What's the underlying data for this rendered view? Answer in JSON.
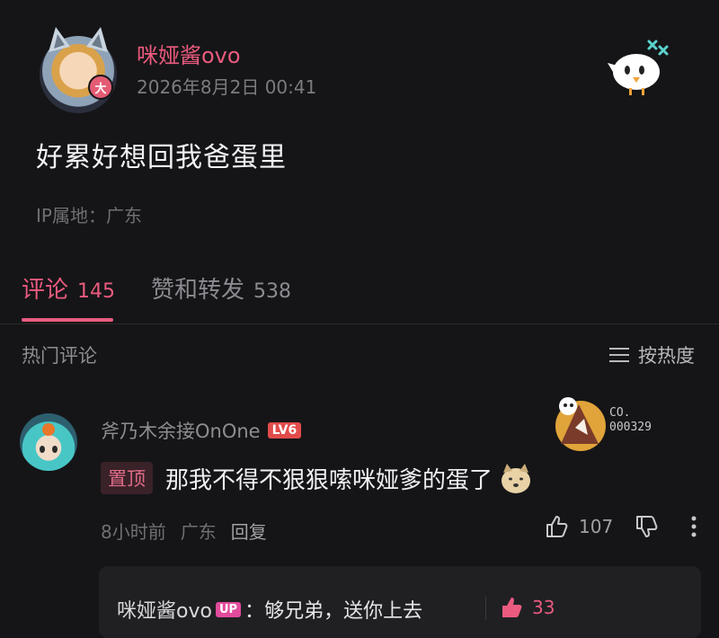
{
  "post": {
    "author": "咪娅酱ovo",
    "level_badge": "大",
    "time": "2026年8月2日 00:41",
    "text": "好累好想回我爸蛋里",
    "ip": "IP属地：广东"
  },
  "tabs": {
    "comments_label": "评论",
    "comments_count": "145",
    "likes_label": "赞和转发",
    "likes_count": "538"
  },
  "section": {
    "hot_title": "热门评论",
    "sort_label": "按热度"
  },
  "comment": {
    "author": "斧乃木余接OnOne",
    "level": "LV6",
    "decoration_number": "CO.\n000329",
    "pinned": "置顶",
    "text": "那我不得不狠狠嗦咪娅爹的蛋了",
    "time": "8小时前",
    "location": "广东",
    "reply_label": "回复",
    "likes": "107"
  },
  "reply": {
    "author": "咪娅酱ovo",
    "badge": "UP",
    "separator": "：",
    "text": "够兄弟，送你上去",
    "likes": "33"
  },
  "colors": {
    "accent": "#ea5b7f",
    "background": "#151517"
  }
}
